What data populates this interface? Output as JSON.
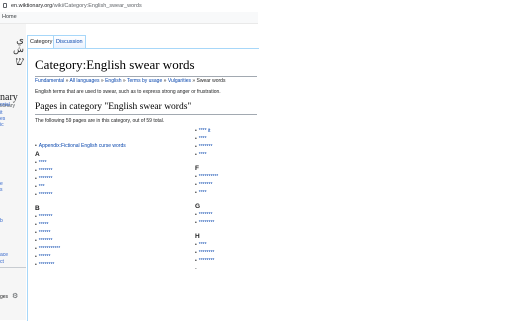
{
  "browser": {
    "url_domain": "en.wiktionary.org",
    "url_path": "/wiki/Category:English_swear_words",
    "bookmark": "Home"
  },
  "sidebar": {
    "logo_glyphs": [
      "ي",
      "ش",
      "ש"
    ],
    "wordmark": "nary",
    "tagline": "tionary",
    "snippets": [
      "ortal",
      "it",
      "es",
      "ic",
      "e",
      "s",
      "b",
      "ace",
      "ct"
    ],
    "control_label": "ges"
  },
  "tabs": [
    {
      "label": "Category"
    },
    {
      "label": "Discussion"
    }
  ],
  "page": {
    "title": "Category:English swear words",
    "breadcrumbs": [
      "Fundamental",
      "All languages",
      "English",
      "Terms by usage",
      "Vulgarities",
      "Swear words"
    ],
    "breadcrumb_sep": " » ",
    "description": "English terms that are used to swear, such as to express strong anger or frustration.",
    "pages_heading": "Pages in category \"English swear words\"",
    "count_text": "The following 59 pages are in this category, out of 59 total."
  },
  "columns": {
    "left": {
      "first_link": "Appendix:Fictional English curse words",
      "groups": [
        {
          "letter": "A",
          "items": [
            "****",
            "*******",
            "*******",
            "***",
            "*******"
          ]
        },
        {
          "letter": "B",
          "items": [
            "*******",
            "*****",
            "******",
            "*******",
            "***********",
            "******",
            "********"
          ]
        }
      ]
    },
    "right": {
      "continued": [
        "**** it",
        "****",
        "*******",
        "****"
      ],
      "groups": [
        {
          "letter": "F",
          "items": [
            "**********",
            "*******",
            "****"
          ]
        },
        {
          "letter": "G",
          "items": [
            "*******",
            "********"
          ]
        },
        {
          "letter": "H",
          "items": [
            "****",
            "********",
            "********"
          ]
        }
      ],
      "trailing": "-"
    }
  },
  "colors": {
    "link": "#0645ad",
    "tab_border": "#a7d7f9",
    "sidebar_bg": "#f6f6f6"
  }
}
